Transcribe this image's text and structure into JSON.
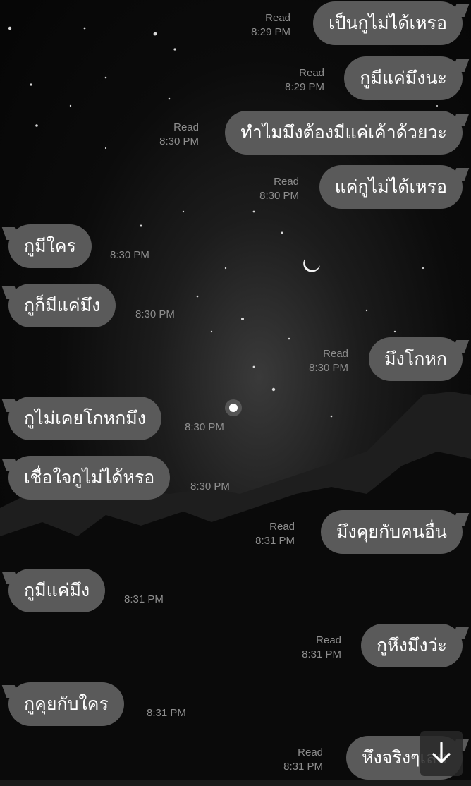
{
  "messages": [
    {
      "dir": "out",
      "text": "เป็นกูไม่ได้เหรอ",
      "status": "Read",
      "time": "8:29 PM"
    },
    {
      "dir": "out",
      "text": "กูมีแค่มึงนะ",
      "status": "Read",
      "time": "8:29 PM"
    },
    {
      "dir": "out",
      "text": "ทำไมมึงต้องมีแค่เค้าด้วยวะ",
      "status": "Read",
      "time": "8:30 PM"
    },
    {
      "dir": "out",
      "text": "แค่กูไม่ได้เหรอ",
      "status": "Read",
      "time": "8:30 PM"
    },
    {
      "dir": "in",
      "text": "กูมีใคร",
      "time": "8:30 PM"
    },
    {
      "dir": "in",
      "text": "กูก็มีแค่มึง",
      "time": "8:30 PM"
    },
    {
      "dir": "out",
      "text": "มึงโกหก",
      "status": "Read",
      "time": "8:30 PM"
    },
    {
      "dir": "in",
      "text": "กูไม่เคยโกหกมึง",
      "time": "8:30 PM"
    },
    {
      "dir": "in",
      "text": "เชื่อใจกูไม่ได้หรอ",
      "time": "8:30 PM"
    },
    {
      "dir": "out",
      "text": "มึงคุยกับคนอื่น",
      "status": "Read",
      "time": "8:31 PM"
    },
    {
      "dir": "in",
      "text": "กูมีแค่มึง",
      "time": "8:31 PM"
    },
    {
      "dir": "out",
      "text": "กูหึงมึงว่ะ",
      "status": "Read",
      "time": "8:31 PM"
    },
    {
      "dir": "in",
      "text": "กูคุยกับใคร",
      "time": "8:31 PM"
    },
    {
      "dir": "out",
      "text": "หึงจริงๆเลย",
      "status": "Read",
      "time": "8:31 PM"
    }
  ],
  "scroll_button_icon": "arrow-down-icon"
}
